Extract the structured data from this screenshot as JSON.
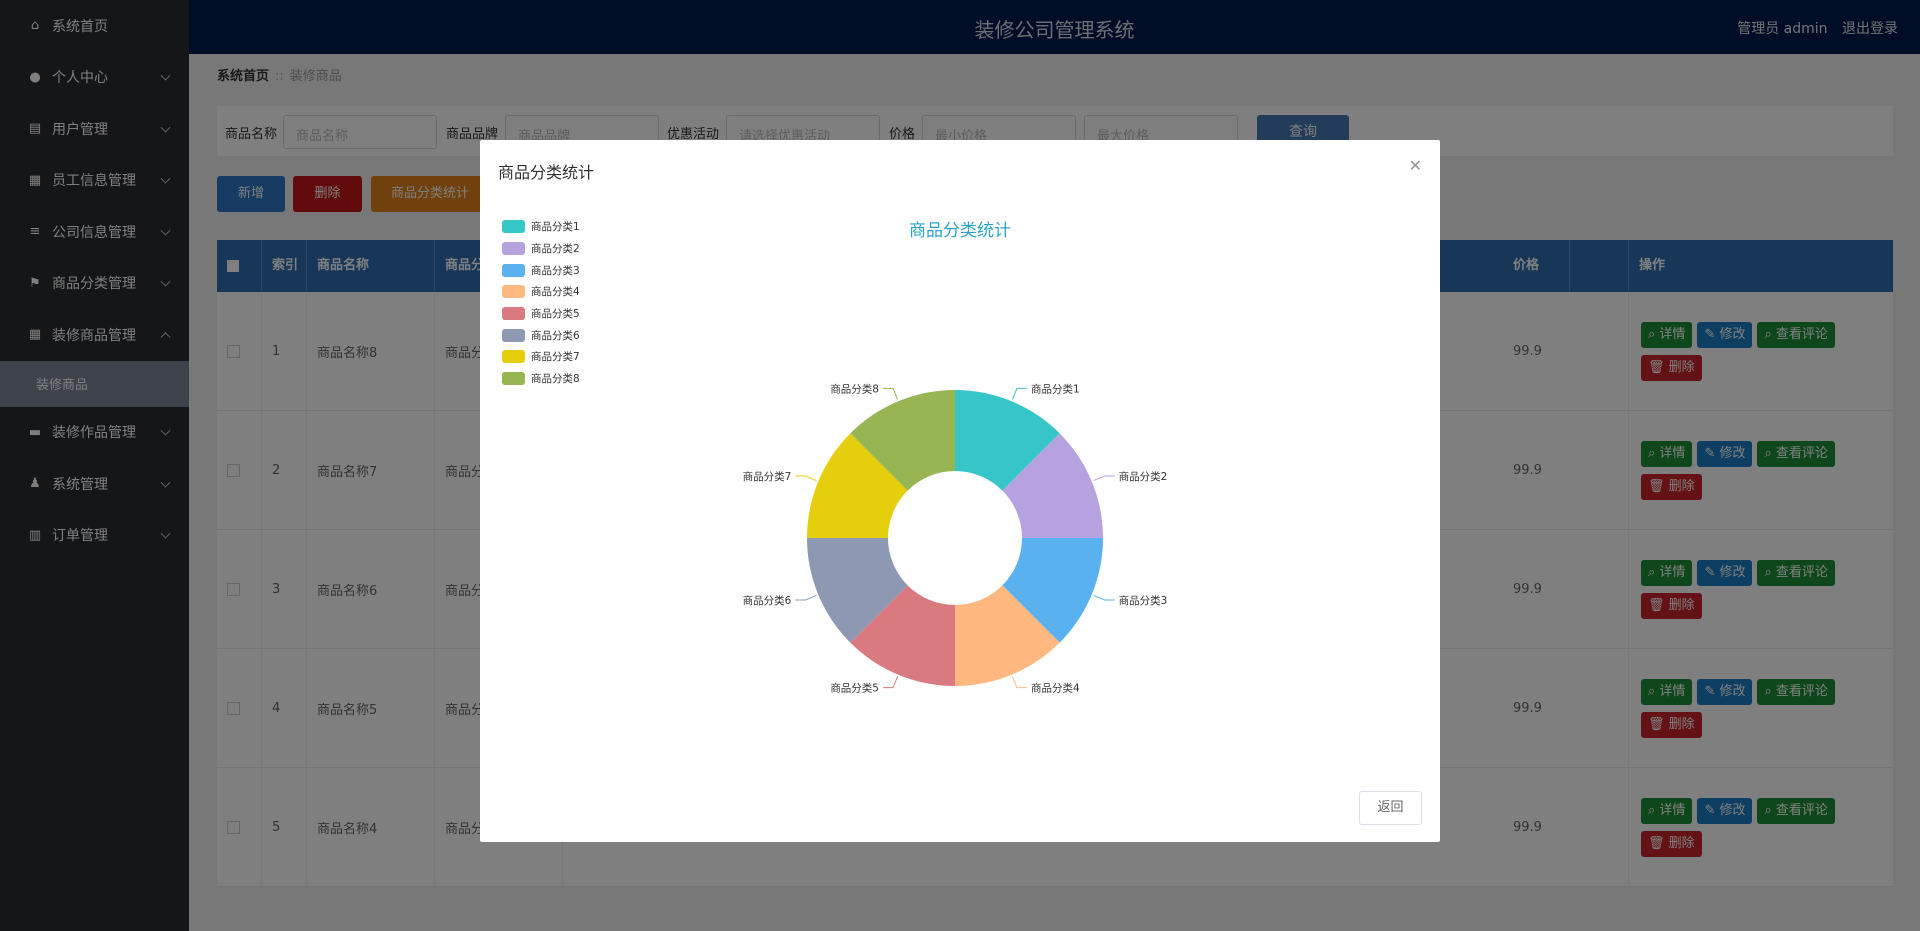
{
  "header": {
    "title": "装修公司管理系统",
    "user_label": "管理员 admin",
    "logout": "退出登录"
  },
  "sidebar": {
    "items": [
      {
        "label": "系统首页",
        "icon": "home-icon",
        "chevron": false
      },
      {
        "label": "个人中心",
        "icon": "user-icon",
        "chevron": true
      },
      {
        "label": "用户管理",
        "icon": "clipboard-icon",
        "chevron": true
      },
      {
        "label": "员工信息管理",
        "icon": "grid-icon",
        "chevron": true
      },
      {
        "label": "公司信息管理",
        "icon": "sliders-icon",
        "chevron": true
      },
      {
        "label": "商品分类管理",
        "icon": "flag-icon",
        "chevron": true
      },
      {
        "label": "装修商品管理",
        "icon": "grid-icon",
        "chevron": true,
        "expanded": true
      },
      {
        "label": "装修作品管理",
        "icon": "briefcase-icon",
        "chevron": true
      },
      {
        "label": "系统管理",
        "icon": "person-icon",
        "chevron": true
      },
      {
        "label": "订单管理",
        "icon": "bars-icon",
        "chevron": true
      }
    ],
    "subitem": "装修商品"
  },
  "breadcrumb": {
    "home": "系统首页",
    "sep": "::",
    "current": "装修商品"
  },
  "search": {
    "name_label": "商品名称",
    "name_placeholder": "商品名称",
    "brand_label": "商品品牌",
    "brand_placeholder": "商品品牌",
    "promo_label": "优惠活动",
    "promo_placeholder": "请选择优惠活动",
    "price_label": "价格",
    "min_placeholder": "最小价格",
    "max_placeholder": "最大价格",
    "query_button": "查询"
  },
  "actions": {
    "add": "新增",
    "delete": "删除",
    "stats": "商品分类统计"
  },
  "table": {
    "headers": {
      "index": "索引",
      "name": "商品名称",
      "category": "商品分",
      "price": "价格",
      "operation": "操作"
    },
    "rows": [
      {
        "index": "1",
        "name": "商品名称8",
        "category": "商品分",
        "price": "99.9"
      },
      {
        "index": "2",
        "name": "商品名称7",
        "category": "商品分",
        "price": "99.9"
      },
      {
        "index": "3",
        "name": "商品名称6",
        "category": "商品分",
        "price": "99.9"
      },
      {
        "index": "4",
        "name": "商品名称5",
        "category": "商品分",
        "price": "99.9"
      },
      {
        "index": "5",
        "name": "商品名称4",
        "category": "商品分",
        "price": "99.9"
      }
    ],
    "ops": {
      "detail": "详情",
      "edit": "修改",
      "comments": "查看评论",
      "delete": "删除"
    }
  },
  "modal": {
    "title": "商品分类统计",
    "back_button": "返回"
  },
  "chart_data": {
    "type": "pie",
    "title": "商品分类统计",
    "donut": true,
    "legend_position": "top-left",
    "categories": [
      "商品分类1",
      "商品分类2",
      "商品分类3",
      "商品分类4",
      "商品分类5",
      "商品分类6",
      "商品分类7",
      "商品分类8"
    ],
    "values": [
      1,
      1,
      1,
      1,
      1,
      1,
      1,
      1
    ],
    "colors": [
      "#37c6c8",
      "#b6a2de",
      "#5ab1ef",
      "#ffb980",
      "#d87a80",
      "#8d98b3",
      "#e5cf0d",
      "#97b552"
    ]
  }
}
